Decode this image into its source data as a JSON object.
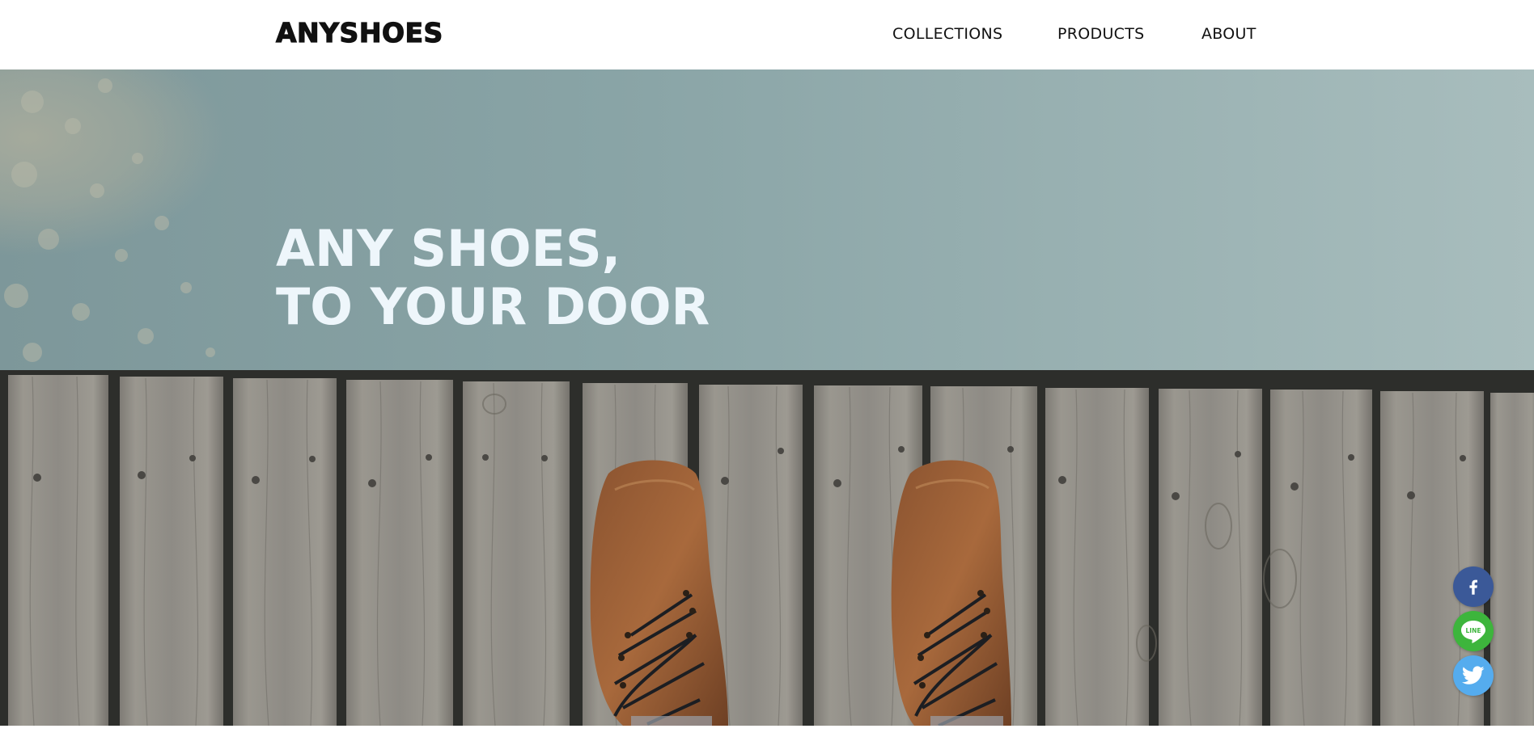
{
  "header": {
    "logo": "ANYSHOES",
    "nav": {
      "collections": "COLLECTIONS",
      "products": "PRODUCTS",
      "about": "ABOUT"
    }
  },
  "hero": {
    "title_line1": "ANY SHOES,",
    "title_line2": "TO YOUR DOOR",
    "image_subject": "brown leather boots standing on a wooden dock over calm water"
  },
  "social": {
    "facebook_icon": "facebook-icon",
    "line_icon": "line-icon",
    "line_label": "LINE",
    "twitter_icon": "twitter-icon"
  },
  "colors": {
    "header_bg": "#ffffff",
    "text_dark": "#111111",
    "hero_title": "#eef6fb",
    "water": "#8aa6a8",
    "wood": "#8c8a84",
    "facebook": "#3b5998",
    "line": "#3db53c",
    "twitter": "#55acee"
  }
}
